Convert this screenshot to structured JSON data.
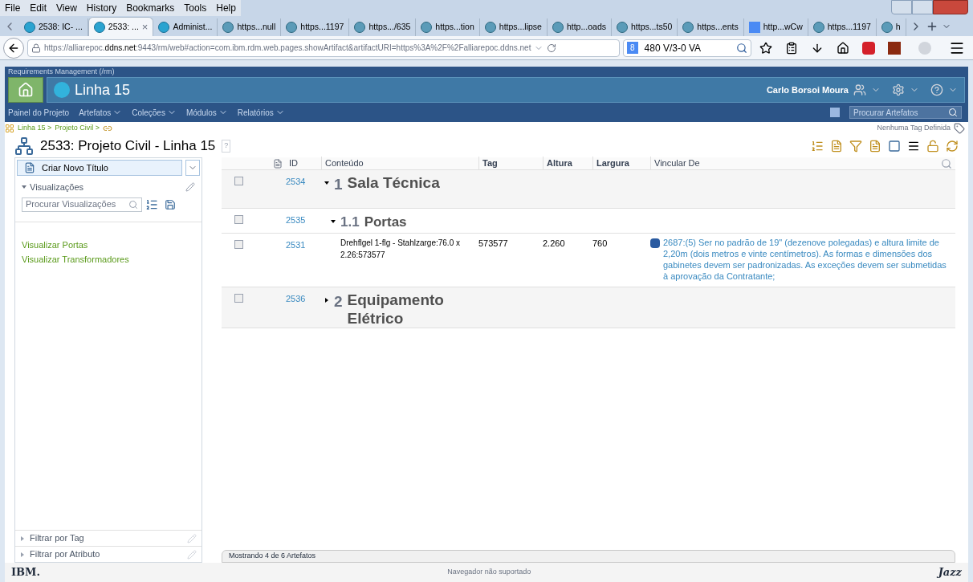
{
  "menu": [
    "File",
    "Edit",
    "View",
    "History",
    "Bookmarks",
    "Tools",
    "Help"
  ],
  "tabs": [
    {
      "label": "2538: IC- ...",
      "kind": "app",
      "selected": false
    },
    {
      "label": "2533: ...",
      "kind": "app",
      "selected": true,
      "close": "×"
    },
    {
      "label": "Administ...",
      "kind": "app",
      "selected": false
    },
    {
      "label": "https...null",
      "kind": "site",
      "selected": false
    },
    {
      "label": "https...1197",
      "kind": "site",
      "selected": false
    },
    {
      "label": "https.../635",
      "kind": "site",
      "selected": false
    },
    {
      "label": "https...tion",
      "kind": "site",
      "selected": false
    },
    {
      "label": "https...lipse",
      "kind": "site",
      "selected": false
    },
    {
      "label": "http...oads",
      "kind": "site",
      "selected": false
    },
    {
      "label": "https...ts50",
      "kind": "site",
      "selected": false
    },
    {
      "label": "https...ents",
      "kind": "site",
      "selected": false
    },
    {
      "label": "http...wCw",
      "kind": "search",
      "selected": false
    },
    {
      "label": "https...1197",
      "kind": "site",
      "selected": false
    },
    {
      "label": "h",
      "kind": "site",
      "selected": false
    }
  ],
  "url": {
    "prefix": "https://alliarepoc.",
    "host": "ddns.net",
    "rest": ":9443/rm/web#action=com.ibm.rdm.web.pages.showArtifact&artifactURI=https%3A%2F%2Falliarepoc.ddns.net"
  },
  "search_engine": {
    "glyph": "8",
    "value": "480 V/3-0 VA"
  },
  "app": {
    "product": "Requirements Management (/rm)",
    "project": "Linha 15",
    "user": "Carlo Borsoi Moura",
    "nav": [
      {
        "label": "Painel do Projeto",
        "dropdown": false
      },
      {
        "label": "Artefatos",
        "dropdown": true
      },
      {
        "label": "Coleções",
        "dropdown": true
      },
      {
        "label": "Módulos",
        "dropdown": true
      },
      {
        "label": "Relatórios",
        "dropdown": true
      }
    ],
    "search": {
      "placeholder": "Procurar Artefatos"
    }
  },
  "breadcrumb": [
    "Linha 15 >",
    "Projeto Civil >"
  ],
  "tags": "Nenhuma Tag Definida",
  "title": "2533: Projeto Civil - Linha 15",
  "help_mark": "?",
  "sidebar": {
    "create_button": "Criar Novo Título",
    "views": {
      "title": "Visualizações",
      "expanded": true,
      "search_placeholder": "Procurar Visualizações",
      "items": [
        "Visualizar Portas",
        "Visualizar Transformadores"
      ]
    },
    "filters": [
      {
        "label": "Filtrar por Tag",
        "expanded": false
      },
      {
        "label": "Filtrar por Atributo",
        "expanded": false
      }
    ]
  },
  "table": {
    "columns": [
      "ID",
      "Conteúdo",
      "Tag",
      "Altura",
      "Largura",
      "Vincular De"
    ],
    "rows": [
      {
        "kind": "section",
        "id": "2534",
        "checked": false,
        "expanded": true,
        "number": "1",
        "title": "Sala Técnica"
      },
      {
        "kind": "subsection",
        "id": "2535",
        "checked": false,
        "expanded": true,
        "number": "1.1",
        "title": "Portas"
      },
      {
        "kind": "text",
        "id": "2531",
        "checked": false,
        "content": "Drehflgel 1-flg - Stahlzarge:76.0 x 2.26:573577",
        "tag": "573577",
        "altura": "2.260",
        "largura": "760",
        "link": "2687:(5) Ser no padrão de 19\" (dezenove polegadas) e altura limite de 2,20m (dois metros e vinte centímetros). As formas e dimensões dos gabinetes devem ser padronizadas. As exceções devem ser submetidas à aprovação da Contratante;"
      },
      {
        "kind": "section",
        "id": "2536",
        "checked": false,
        "expanded": false,
        "number": "2",
        "title": "Equipamento Elétrico"
      }
    ],
    "status": "Mostrando 4 de 6 Artefatos"
  },
  "footer": {
    "ibm": "IBM.",
    "note": "Navegador não suportado",
    "jazz": "Jazz"
  }
}
